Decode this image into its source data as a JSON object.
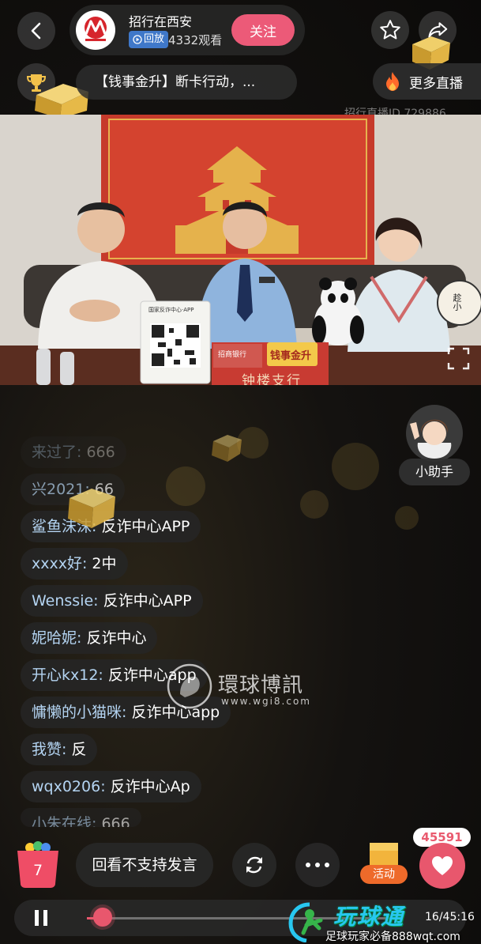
{
  "header": {
    "host_name": "招行在西安",
    "replay_badge": "回放",
    "viewers": "4332观看",
    "follow_label": "关注"
  },
  "notice": {
    "text": "【钱事金升】断卡行动，...",
    "more_live_label": "更多直播",
    "live_id": "招行直播ID 729886"
  },
  "video": {
    "qr_card_title": "国家反诈中心·APP",
    "desk_label": "钟楼支行",
    "desk_logo": "招商银行",
    "sign_text": "钱事金升",
    "fan_text": "趁小"
  },
  "assistant": {
    "label": "小助手"
  },
  "comments": [
    {
      "user": "来过了:",
      "msg": " 666"
    },
    {
      "user": "兴2021:",
      "msg": " 66"
    },
    {
      "user": "鲨鱼沫沫:",
      "msg": " 反诈中心APP"
    },
    {
      "user": "xxxx好:",
      "msg": " 2中"
    },
    {
      "user": "Wenssie:",
      "msg": " 反诈中心APP"
    },
    {
      "user": "妮哈妮:",
      "msg": " 反诈中心"
    },
    {
      "user": "开心kx12:",
      "msg": " 反诈中心app"
    },
    {
      "user": "慵懒的小猫咪:",
      "msg": " 反诈中心app"
    },
    {
      "user": "我赞:",
      "msg": " 反"
    },
    {
      "user": "wqx0206:",
      "msg": " 反诈中心Ap"
    },
    {
      "user": "小朱在线:",
      "msg": " 666"
    }
  ],
  "bottom": {
    "bag_count": "7",
    "no_comment_label": "回看不支持发言",
    "activity_label": "活动",
    "like_count": "45591"
  },
  "player": {
    "time": "16/45:16",
    "progress": 0.05
  },
  "watermarks": {
    "wgi_title": "環球博訊",
    "wgi_url": "www.wgi8.com",
    "wqt_title": "玩球通",
    "wqt_sub": "足球玩家必备888wqt.com"
  },
  "colors": {
    "accent": "#e8576d",
    "follow": "#ec5a78",
    "replay_badge": "#3f78c9",
    "username": "#b4d4f2"
  }
}
